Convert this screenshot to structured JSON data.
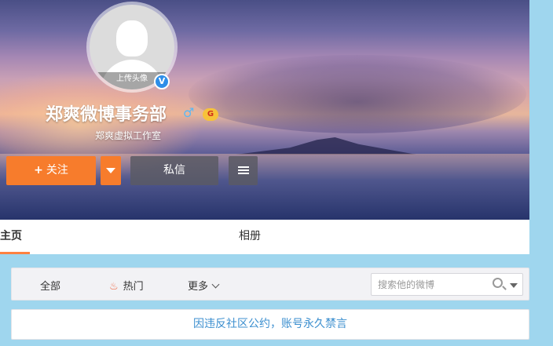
{
  "profile": {
    "upload_avatar_label": "上传头像",
    "verified_badge": "V",
    "name": "郑爽微博事务部",
    "gender_symbol": "♂",
    "level_badge": "G",
    "subtitle": "郑爽虚拟工作室"
  },
  "actions": {
    "follow_plus": "+",
    "follow_label": "关注",
    "message_label": "私信"
  },
  "tabs": {
    "home": "主页",
    "album": "相册"
  },
  "filters": {
    "all": "全部",
    "hot": "热门",
    "more": "更多"
  },
  "search": {
    "placeholder": "搜索他的微博"
  },
  "notice": {
    "text": "因违反社区公约，账号永久禁言"
  },
  "colors": {
    "accent_orange": "#f77c2c",
    "tab_underline": "#ff8140",
    "notice_blue": "#3c8fcf",
    "page_bg": "#9fd6ee",
    "verify_blue": "#2e8ee8"
  },
  "icons": [
    "plus-icon",
    "chevron-down-icon",
    "menu-icon",
    "flame-icon",
    "search-icon",
    "male-icon",
    "verified-icon",
    "level-icon"
  ]
}
